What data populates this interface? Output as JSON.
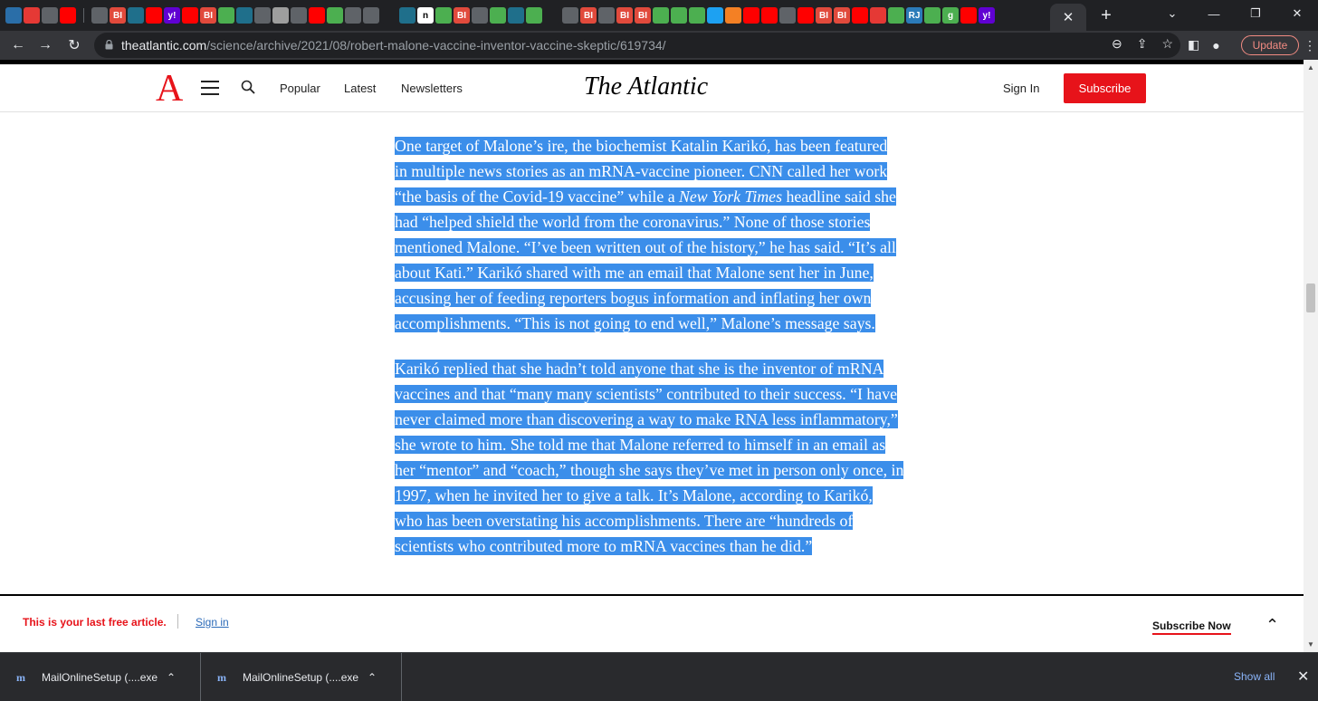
{
  "browser": {
    "tabs": [
      {
        "icon": "bleacher-icon",
        "label": "",
        "bg": "#2a6ea8"
      },
      {
        "icon": "flower-icon",
        "label": "",
        "bg": "#e53935"
      },
      {
        "icon": "globe-icon",
        "label": "",
        "bg": "#5f6368"
      },
      {
        "icon": "youtube-icon",
        "label": "",
        "bg": "#ff0000"
      },
      {
        "icon": "globe-icon",
        "label": "",
        "bg": "#5f6368"
      },
      {
        "icon": "bi-icon",
        "label": "BI",
        "bg": "#e14a3c"
      },
      {
        "icon": "globe-icon",
        "label": "",
        "bg": "#1f6f8b"
      },
      {
        "icon": "youtube-icon",
        "label": "",
        "bg": "#ff0000"
      },
      {
        "icon": "yahoo-icon",
        "label": "y!",
        "bg": "#6001d2"
      },
      {
        "icon": "youtube-icon",
        "label": "",
        "bg": "#ff0000"
      },
      {
        "icon": "bi-icon",
        "label": "BI",
        "bg": "#e14a3c"
      },
      {
        "icon": "play-icon",
        "label": "",
        "bg": "#4caf50"
      },
      {
        "icon": "globe-icon",
        "label": "",
        "bg": "#1f6f8b"
      },
      {
        "icon": "arrow-icon",
        "label": "",
        "bg": "#5f6368"
      },
      {
        "icon": "grid-icon",
        "label": "",
        "bg": "#9e9e9e"
      },
      {
        "icon": "globe-icon",
        "label": "",
        "bg": "#5f6368"
      },
      {
        "icon": "youtube-icon",
        "label": "",
        "bg": "#ff0000"
      },
      {
        "icon": "play-icon",
        "label": "",
        "bg": "#4caf50"
      },
      {
        "icon": "globe-icon",
        "label": "",
        "bg": "#5f6368"
      },
      {
        "icon": "arrow-icon",
        "label": "",
        "bg": "#5f6368"
      },
      {
        "icon": "search-icon",
        "label": "",
        "bg": "#202124"
      },
      {
        "icon": "globe-icon",
        "label": "",
        "bg": "#1f6f8b"
      },
      {
        "icon": "n-icon",
        "label": "n",
        "bg": "#ffffff"
      },
      {
        "icon": "play-icon",
        "label": "",
        "bg": "#4caf50"
      },
      {
        "icon": "bi-icon",
        "label": "BI",
        "bg": "#e14a3c"
      },
      {
        "icon": "globe-icon",
        "label": "",
        "bg": "#5f6368"
      },
      {
        "icon": "play-icon",
        "label": "",
        "bg": "#4caf50"
      },
      {
        "icon": "arrow-icon",
        "label": "",
        "bg": "#1f6f8b"
      },
      {
        "icon": "play-icon",
        "label": "",
        "bg": "#4caf50"
      },
      {
        "icon": "search-icon",
        "label": "",
        "bg": "#202124"
      },
      {
        "icon": "arrow-icon",
        "label": "",
        "bg": "#5f6368"
      },
      {
        "icon": "bi-icon",
        "label": "BI",
        "bg": "#e14a3c"
      },
      {
        "icon": "atlantic-icon",
        "label": "",
        "bg": "#5f6368"
      },
      {
        "icon": "bi-icon",
        "label": "BI",
        "bg": "#e14a3c"
      },
      {
        "icon": "bi-icon",
        "label": "BI",
        "bg": "#e14a3c"
      },
      {
        "icon": "play-icon",
        "label": "",
        "bg": "#4caf50"
      },
      {
        "icon": "play-icon",
        "label": "",
        "bg": "#4caf50"
      },
      {
        "icon": "play-icon",
        "label": "",
        "bg": "#4caf50"
      },
      {
        "icon": "twitter-icon",
        "label": "",
        "bg": "#1da1f2"
      },
      {
        "icon": "stack-icon",
        "label": "",
        "bg": "#f48024"
      },
      {
        "icon": "youtube-icon",
        "label": "",
        "bg": "#ff0000"
      },
      {
        "icon": "youtube-icon",
        "label": "",
        "bg": "#ff0000"
      },
      {
        "icon": "globe-icon",
        "label": "",
        "bg": "#5f6368"
      },
      {
        "icon": "youtube-icon",
        "label": "",
        "bg": "#ff0000"
      },
      {
        "icon": "bi-icon",
        "label": "BI",
        "bg": "#e14a3c"
      },
      {
        "icon": "bi-icon",
        "label": "BI",
        "bg": "#e14a3c"
      },
      {
        "icon": "youtube-icon",
        "label": "",
        "bg": "#ff0000"
      },
      {
        "icon": "mic-icon",
        "label": "",
        "bg": "#e53935"
      },
      {
        "icon": "play-icon",
        "label": "",
        "bg": "#4caf50"
      },
      {
        "icon": "rj-icon",
        "label": "RJ",
        "bg": "#2b7bb9"
      },
      {
        "icon": "play-icon",
        "label": "",
        "bg": "#4caf50"
      },
      {
        "icon": "g-icon",
        "label": "g",
        "bg": "#4caf50"
      },
      {
        "icon": "youtube-icon",
        "label": "",
        "bg": "#ff0000"
      },
      {
        "icon": "yahoo-icon",
        "label": "y!",
        "bg": "#6001d2"
      }
    ],
    "url_domain": "theatlantic.com",
    "url_path": "/science/archive/2021/08/robert-malone-vaccine-inventor-vaccine-skeptic/619734/",
    "update_label": "Update"
  },
  "site": {
    "logo_letter": "A",
    "brand": "The Atlantic",
    "nav": [
      "Popular",
      "Latest",
      "Newsletters"
    ],
    "sign_in": "Sign In",
    "subscribe": "Subscribe",
    "accent": "#e7131a"
  },
  "article": {
    "selection_color": "#3b8eea",
    "paragraphs": [
      [
        [
          "One target of Malone’s ire, the biochemist Katalin Karikó, has been featured"
        ],
        [
          "in multiple news stories as an mRNA-vaccine pioneer. CNN called her work"
        ],
        [
          "“the basis of the Covid-19 vaccine” while a ",
          "New York Times",
          " headline said she"
        ],
        [
          "had “helped shield the world from the coronavirus.” None of those stories"
        ],
        [
          "mentioned Malone. “I’ve been written out of the history,” he has said. “It’s all"
        ],
        [
          "about Kati.” Karikó shared with me an email that Malone sent her in June,"
        ],
        [
          "accusing her of feeding reporters bogus information and inflating her own"
        ],
        [
          "accomplishments. “This is not going to end well,” Malone’s message says."
        ]
      ],
      [
        [
          "Karikó replied that she hadn’t told anyone that she is the inventor of mRNA"
        ],
        [
          "vaccines and that “many many scientists” contributed to their success. “I have"
        ],
        [
          "never claimed more than discovering a way to make RNA less inflammatory,”"
        ],
        [
          "she wrote to him. She told me that Malone referred to himself in an email as"
        ],
        [
          "her “mentor” and “coach,” though she says they’ve met in person only once, in"
        ],
        [
          "1997, when he invited her to give a talk. It’s Malone, according to Karikó,"
        ],
        [
          "who has been overstating his accomplishments. There are “hundreds of"
        ],
        [
          "scientists who contributed more to mRNA vaccines than he did.”"
        ]
      ]
    ]
  },
  "paywall": {
    "message": "This is your last free article.",
    "sign_in": "Sign in",
    "subscribe_now": "Subscribe Now"
  },
  "downloads": {
    "items": [
      {
        "name": "MailOnlineSetup (....exe",
        "icon": "m"
      },
      {
        "name": "MailOnlineSetup (....exe",
        "icon": "m"
      }
    ],
    "show_all": "Show all"
  }
}
